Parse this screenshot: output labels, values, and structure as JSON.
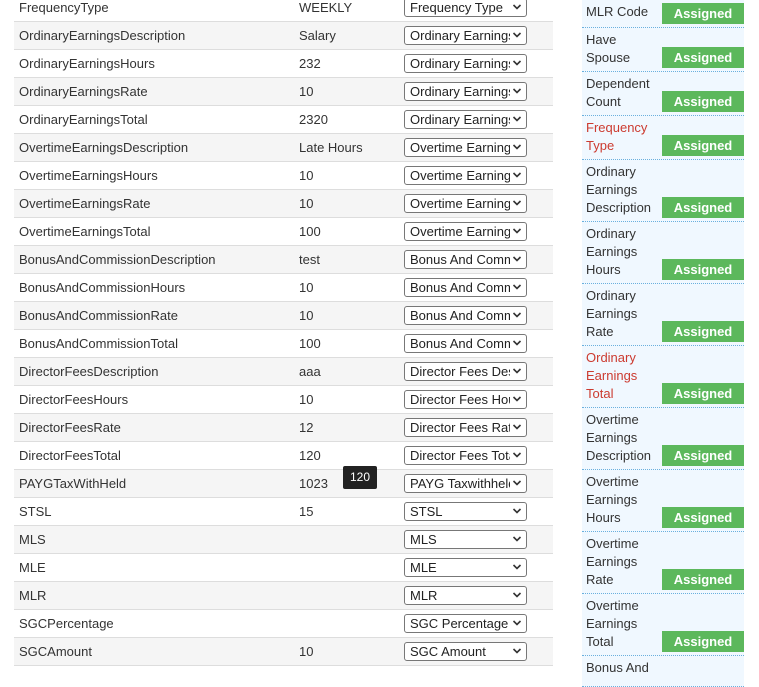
{
  "mapping": {
    "rows": [
      {
        "name": "FrequencyType",
        "value": "WEEKLY",
        "selected": "Frequency Type"
      },
      {
        "name": "OrdinaryEarningsDescription",
        "value": "Salary",
        "selected": "Ordinary Earnings Description"
      },
      {
        "name": "OrdinaryEarningsHours",
        "value": "232",
        "selected": "Ordinary Earnings Hours"
      },
      {
        "name": "OrdinaryEarningsRate",
        "value": "10",
        "selected": "Ordinary Earnings Rate"
      },
      {
        "name": "OrdinaryEarningsTotal",
        "value": "2320",
        "selected": "Ordinary Earnings Total"
      },
      {
        "name": "OvertimeEarningsDescription",
        "value": "Late Hours",
        "selected": "Overtime Earnings Description"
      },
      {
        "name": "OvertimeEarningsHours",
        "value": "10",
        "selected": "Overtime Earnings Hours"
      },
      {
        "name": "OvertimeEarningsRate",
        "value": "10",
        "selected": "Overtime Earnings Rate"
      },
      {
        "name": "OvertimeEarningsTotal",
        "value": "100",
        "selected": "Overtime Earnings Total"
      },
      {
        "name": "BonusAndCommissionDescription",
        "value": "test",
        "selected": "Bonus And Commission Description"
      },
      {
        "name": "BonusAndCommissionHours",
        "value": "10",
        "selected": "Bonus And Commission Hours"
      },
      {
        "name": "BonusAndCommissionRate",
        "value": "10",
        "selected": "Bonus And Commission Rate"
      },
      {
        "name": "BonusAndCommissionTotal",
        "value": "100",
        "selected": "Bonus And Commission Total"
      },
      {
        "name": "DirectorFeesDescription",
        "value": "aaa",
        "selected": "Director Fees Description"
      },
      {
        "name": "DirectorFeesHours",
        "value": "10",
        "selected": "Director Fees Hours"
      },
      {
        "name": "DirectorFeesRate",
        "value": "12",
        "selected": "Director Fees Rate"
      },
      {
        "name": "DirectorFeesTotal",
        "value": "120",
        "selected": "Director Fees Total"
      },
      {
        "name": "PAYGTaxWithHeld",
        "value": "1023",
        "selected": "PAYG Taxwithheld"
      },
      {
        "name": "STSL",
        "value": "15",
        "selected": "STSL"
      },
      {
        "name": "MLS",
        "value": "",
        "selected": "MLS"
      },
      {
        "name": "MLE",
        "value": "",
        "selected": "MLE"
      },
      {
        "name": "MLR",
        "value": "",
        "selected": "MLR"
      },
      {
        "name": "SGCPercentage",
        "value": "",
        "selected": "SGC Percentage"
      },
      {
        "name": "SGCAmount",
        "value": "10",
        "selected": "SGC Amount"
      }
    ]
  },
  "tooltip": {
    "text": "120"
  },
  "status_panel": {
    "items": [
      {
        "label": "MLR Code",
        "badge": "Assigned",
        "warn": false
      },
      {
        "label": "Have Spouse",
        "badge": "Assigned",
        "warn": false
      },
      {
        "label": "Dependent Count",
        "badge": "Assigned",
        "warn": false
      },
      {
        "label": "Frequency Type",
        "badge": "Assigned",
        "warn": true
      },
      {
        "label": "Ordinary Earnings Description",
        "badge": "Assigned",
        "warn": false
      },
      {
        "label": "Ordinary Earnings Hours",
        "badge": "Assigned",
        "warn": false
      },
      {
        "label": "Ordinary Earnings Rate",
        "badge": "Assigned",
        "warn": false
      },
      {
        "label": "Ordinary Earnings Total",
        "badge": "Assigned",
        "warn": true
      },
      {
        "label": "Overtime Earnings Description",
        "badge": "Assigned",
        "warn": false
      },
      {
        "label": "Overtime Earnings Hours",
        "badge": "Assigned",
        "warn": false
      },
      {
        "label": "Overtime Earnings Rate",
        "badge": "Assigned",
        "warn": false
      },
      {
        "label": "Overtime Earnings Total",
        "badge": "Assigned",
        "warn": false
      },
      {
        "label": "Bonus And",
        "badge": "",
        "warn": false
      }
    ]
  },
  "colors": {
    "assigned_badge": "#5cb85c",
    "warning_text": "#cc3b30",
    "row_alt": "#f5f5f5",
    "status_bg": "#f0f8ff",
    "status_divider": "#6ab0de"
  },
  "icons": {
    "dropdown": "chevron-down-icon"
  }
}
